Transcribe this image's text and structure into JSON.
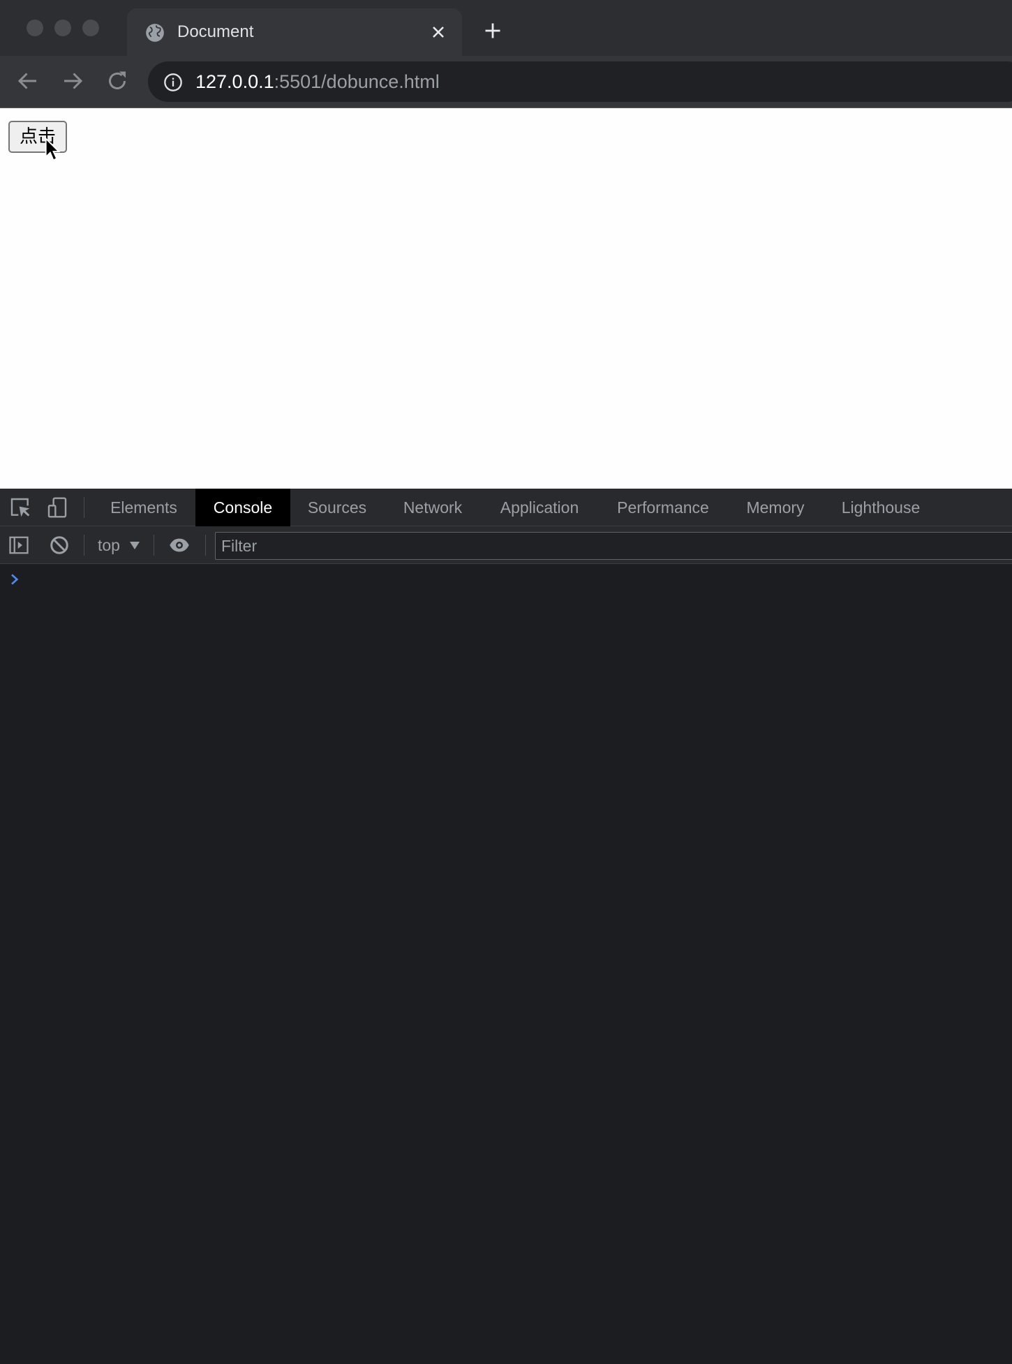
{
  "window": {
    "tab": {
      "title": "Document",
      "favicon": "globe-icon"
    },
    "new_tab_icon": "plus-icon"
  },
  "toolbar": {
    "url_host": "127.0.0.1",
    "url_rest": ":5501/dobunce.html"
  },
  "page": {
    "button_label": "点击"
  },
  "devtools": {
    "tabs": [
      "Elements",
      "Console",
      "Sources",
      "Network",
      "Application",
      "Performance",
      "Memory",
      "Lighthouse"
    ],
    "active_tab": "Console",
    "console": {
      "context": "top",
      "filter_placeholder": "Filter"
    }
  },
  "colors": {
    "chrome_bg": "#2d2e32",
    "toolbar_bg": "#35363a",
    "devtools_bg": "#1c1d21",
    "active_tab_bg": "#000000",
    "prompt_accent": "#4d8af0"
  }
}
